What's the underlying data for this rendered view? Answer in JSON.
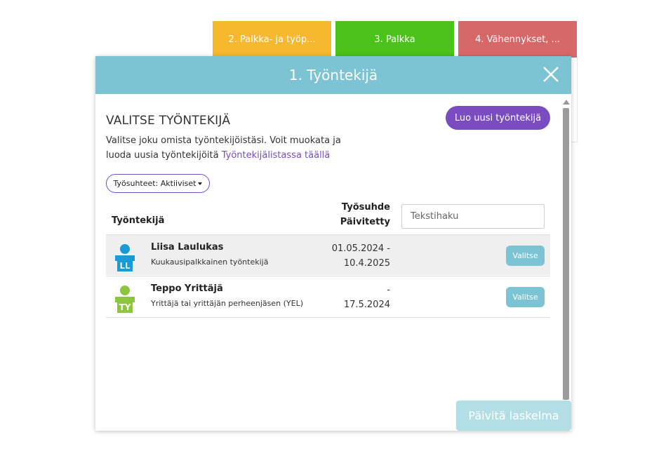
{
  "tabs": [
    {
      "label": "2. Palkka- ja työp...",
      "color": "#f5b82e"
    },
    {
      "label": "3. Palkka",
      "color": "#4dc21a"
    },
    {
      "label": "4. Vähennykset, ...",
      "color": "#d8676a"
    }
  ],
  "dialog": {
    "title": "1. Työntekijä",
    "close_icon": "close-icon",
    "section_title": "VALITSE TYÖNTEKIJÄ",
    "new_employee_button": "Luo uusi työntekijä",
    "intro_text": "Valitse joku omista työntekijöistäsi. Voit muokata ja luoda uusia työntekijöitä",
    "intro_link": "Työntekijälistassa täällä",
    "filter_label": "Työsuhteet: Aktiiviset",
    "columns": {
      "employee": "Työntekijä",
      "date_line1": "Työsuhde",
      "date_line2": "Päivitetty"
    },
    "search_placeholder": "Tekstihaku",
    "employees": [
      {
        "name": "Liisa Laulukas",
        "type": "Kuukausipalkkainen työntekijä",
        "dates_line1": "01.05.2024 -",
        "dates_line2": "10.4.2025",
        "initials": "LL",
        "avatar_color": "#1a9ad6",
        "select_label": "Valitse"
      },
      {
        "name": "Teppo Yrittäjä",
        "type": "Yrittäjä tai yrittäjän perheenjäsen (YEL)",
        "dates_line1": "-",
        "dates_line2": "17.5.2024",
        "initials": "TY",
        "avatar_color": "#8cc63f",
        "select_label": "Valitse"
      }
    ]
  },
  "update_button": "Päivitä laskelma",
  "colors": {
    "accent_purple": "#7b4bc0",
    "header_teal": "#7cc3d3"
  }
}
